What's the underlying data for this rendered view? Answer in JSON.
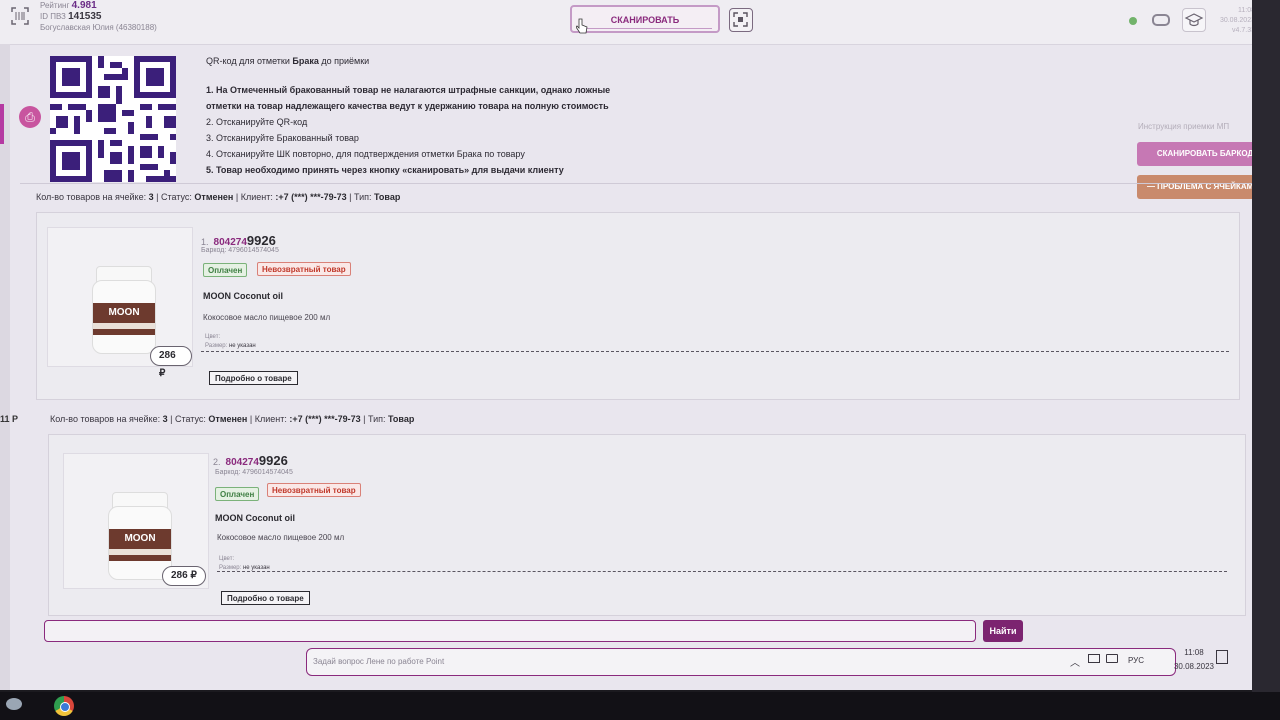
{
  "header": {
    "rating_label": "Рейтинг",
    "rating_value": "4.981",
    "pvz_label": "ID ПВЗ",
    "pvz_id": "141535",
    "user": "Богуславская Юлия (46380188)",
    "scan_button": "СКАНИРОВАТЬ",
    "right_info": [
      "11:08",
      "30.08.2023",
      "v4.7.33"
    ]
  },
  "qr_section": {
    "title_prefix": "QR-код для отметки ",
    "title_bold": "Брака",
    "title_suffix": " до приёмки",
    "steps": [
      "1. На Отмеченный бракованный товар не налагаются штрафные санкции, однако ложные",
      "отметки на товар надлежащего качества ведут к удержанию товара на полную стоимость",
      "2. Отсканируйте QR-код",
      "3. Отсканируйте Бракованный товар",
      "4. Отсканируйте ШК повторно, для подтверждения отметки Брака по товару",
      "5. Товар необходимо принять через кнопку «сканировать» для выдачи клиенту"
    ],
    "instruction_link": "Инструкция приемки МП",
    "scan_barcode_button": "СКАНИРОВАТЬ БАРКОД",
    "cell_problem_button": "— ПРОБЛЕМА С ЯЧЕЙКАМИ"
  },
  "blocks": [
    {
      "summary_prefix": "Кол-во товаров на ячейке: ",
      "count": "3",
      "status_label": " | Статус: ",
      "status": "Отменен",
      "client_label": " | Клиент: ",
      "client": ":+7 (***) ***-79-73",
      "type_label": " | Тип: ",
      "type": "Товар",
      "item": {
        "index": "1.",
        "article_a": "804274",
        "article_b": "9926",
        "barcode": "Баркод: 4796014574045",
        "badge_paid": "Оплачен",
        "badge_nonreturn": "Невозвратный товар",
        "name": "MOON Coconut oil",
        "description": "Кокосовое масло пищевое 200 мл",
        "color_label": "Цвет:",
        "size_label": "Размер:",
        "size_value": "не указан",
        "price": "286 ₽",
        "jar_brand": "MOON",
        "more_button": "Подробно о товаре"
      }
    },
    {
      "summary_prefix": "Кол-во товаров на ячейке: ",
      "count": "3",
      "status_label": " | Статус: ",
      "status": "Отменен",
      "client_label": " | Клиент: ",
      "client": ":+7 (***) ***-79-73",
      "type_label": " | Тип: ",
      "type": "Товар",
      "item": {
        "index": "2.",
        "article_a": "804274",
        "article_b": "9926",
        "barcode": "Баркод: 4796014574045",
        "badge_paid": "Оплачен",
        "badge_nonreturn": "Невозвратный товар",
        "name": "MOON Coconut oil",
        "description": "Кокосовое масло пищевое 200 мл",
        "color_label": "Цвет:",
        "size_label": "Размер:",
        "size_value": "не указан",
        "price": "286 ₽",
        "jar_brand": "MOON",
        "more_button": "Подробно о товаре"
      }
    }
  ],
  "side_number": "11 Р",
  "bottom": {
    "find_button": "Найти",
    "ask_placeholder": "Задай вопрос Лене по работе Point"
  },
  "tray": {
    "lang": "РУС",
    "time": "11:08",
    "date": "30.08.2023"
  }
}
